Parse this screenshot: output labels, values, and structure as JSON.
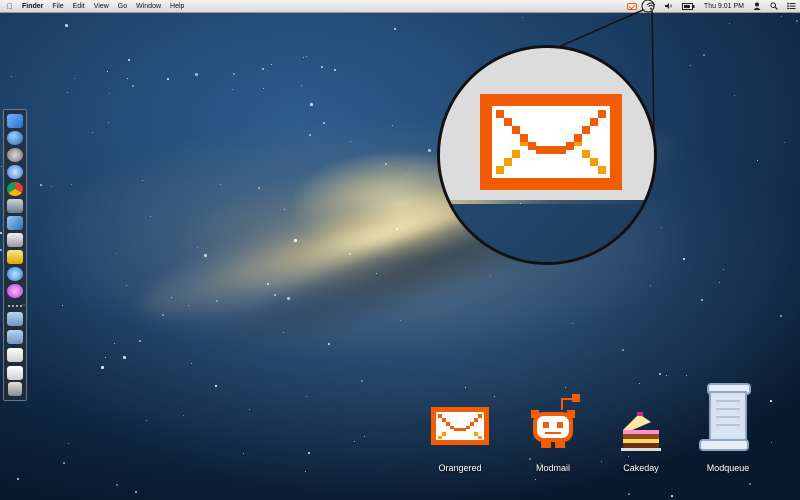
{
  "menubar": {
    "apple_icon": "apple-icon",
    "app_name": "Finder",
    "menus": [
      "File",
      "Edit",
      "View",
      "Go",
      "Window",
      "Help"
    ],
    "status": {
      "icons": [
        "mail-notification-icon",
        "wifi-icon",
        "volume-icon",
        "battery-icon",
        "user-icon",
        "search-icon",
        "list-icon"
      ],
      "clock": "Thu 9:01 PM"
    }
  },
  "magnifier": {
    "subject": "envelope-icon",
    "colors": {
      "envelope": "#f25c05",
      "envelope_light": "#ffffff",
      "shadow": "#f5a000",
      "background": "#dcdcdc"
    }
  },
  "dock": {
    "items": [
      "finder-icon",
      "dashboard-icon",
      "launchpad-icon",
      "itunes-icon",
      "chrome-icon",
      "automator-icon",
      "app-store-icon",
      "preview-icon",
      "stickies-icon",
      "safari-icon",
      "flower-icon"
    ],
    "stack_items": [
      "folder-icon",
      "folder-icon",
      "document-icon",
      "document-icon"
    ],
    "trash": "trash-icon"
  },
  "desktop_icons": [
    {
      "name": "orangered-icon",
      "label": "Orangered"
    },
    {
      "name": "modmail-icon",
      "label": "Modmail"
    },
    {
      "name": "cakeday-icon",
      "label": "Cakeday"
    },
    {
      "name": "modqueue-icon",
      "label": "Modqueue"
    }
  ]
}
